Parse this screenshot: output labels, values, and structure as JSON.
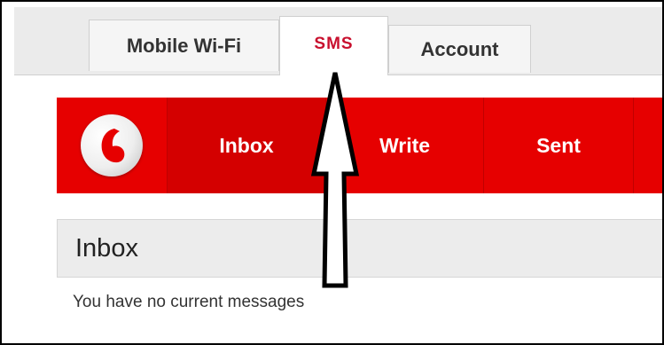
{
  "tabs": [
    {
      "label": "Mobile Wi-Fi",
      "active": false
    },
    {
      "label": "SMS",
      "active": true
    },
    {
      "label": "Account",
      "active": false
    }
  ],
  "nav": {
    "logo": "vodafone-logo",
    "items": [
      {
        "label": "Inbox",
        "active": true
      },
      {
        "label": "Write",
        "active": false
      },
      {
        "label": "Sent",
        "active": false
      }
    ]
  },
  "inbox": {
    "title": "Inbox",
    "empty_message": "You have no current messages"
  },
  "colors": {
    "brand_red": "#e60000",
    "active_tab_text": "#c8102e"
  },
  "annotation": {
    "icon": "up-arrow-icon"
  }
}
